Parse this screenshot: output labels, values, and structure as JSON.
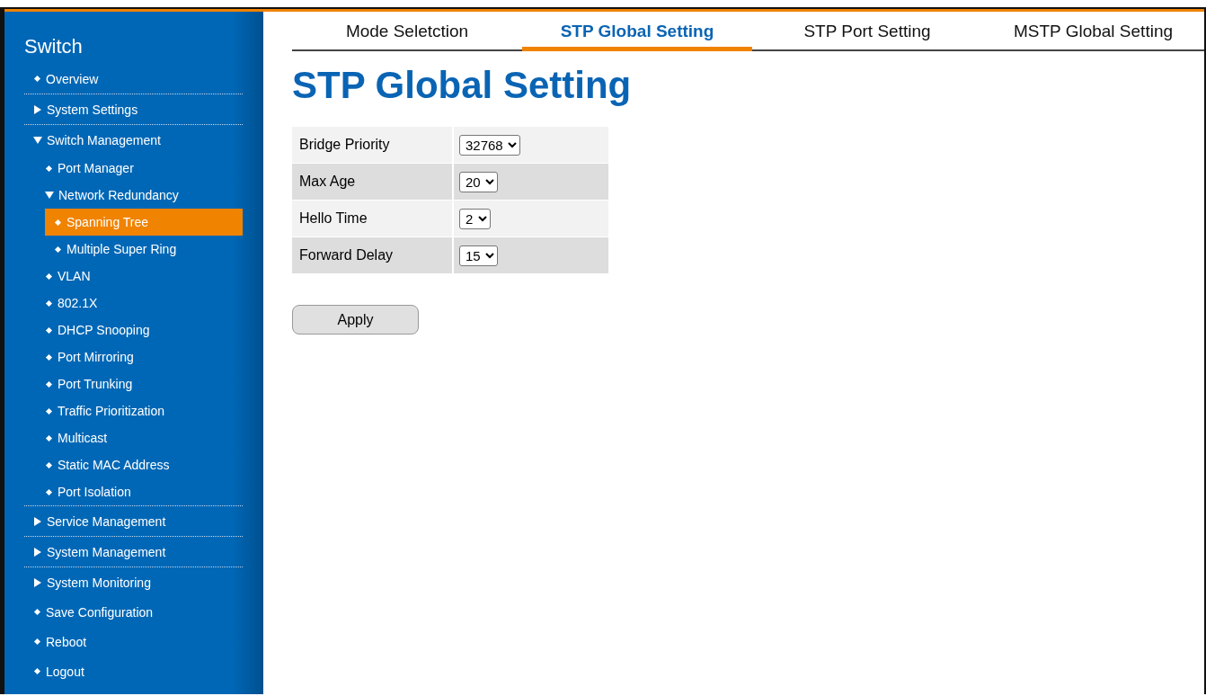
{
  "sidebar": {
    "title": "Switch",
    "items": [
      {
        "label": "Overview",
        "kind": "link",
        "selected": false
      },
      {
        "label": "System Settings",
        "kind": "group",
        "expanded": false,
        "selected": false
      },
      {
        "label": "Switch Management",
        "kind": "group",
        "expanded": true,
        "selected": false,
        "children": [
          {
            "label": "Port Manager",
            "kind": "link",
            "selected": false
          },
          {
            "label": "Network Redundancy",
            "kind": "group",
            "expanded": true,
            "selected": false,
            "children": [
              {
                "label": "Spanning Tree",
                "kind": "link",
                "selected": true
              },
              {
                "label": "Multiple Super Ring",
                "kind": "link",
                "selected": false
              }
            ]
          },
          {
            "label": "VLAN",
            "kind": "link",
            "selected": false
          },
          {
            "label": "802.1X",
            "kind": "link",
            "selected": false
          },
          {
            "label": "DHCP Snooping",
            "kind": "link",
            "selected": false
          },
          {
            "label": "Port Mirroring",
            "kind": "link",
            "selected": false
          },
          {
            "label": "Port Trunking",
            "kind": "link",
            "selected": false
          },
          {
            "label": "Traffic Prioritization",
            "kind": "link",
            "selected": false
          },
          {
            "label": "Multicast",
            "kind": "link",
            "selected": false
          },
          {
            "label": "Static MAC Address",
            "kind": "link",
            "selected": false
          },
          {
            "label": "Port Isolation",
            "kind": "link",
            "selected": false
          }
        ]
      },
      {
        "label": "Service Management",
        "kind": "group",
        "expanded": false,
        "selected": false
      },
      {
        "label": "System Management",
        "kind": "group",
        "expanded": false,
        "selected": false
      },
      {
        "label": "System Monitoring",
        "kind": "group",
        "expanded": false,
        "selected": false
      },
      {
        "label": "Save Configuration",
        "kind": "link",
        "selected": false
      },
      {
        "label": "Reboot",
        "kind": "link",
        "selected": false
      },
      {
        "label": "Logout",
        "kind": "link",
        "selected": false
      }
    ]
  },
  "tabs": [
    {
      "label": "Mode Seletction",
      "selected": false
    },
    {
      "label": "STP Global Setting",
      "selected": true
    },
    {
      "label": "STP Port Setting",
      "selected": false
    },
    {
      "label": "MSTP Global Setting",
      "selected": false
    }
  ],
  "heading": "STP Global Setting",
  "settings": [
    {
      "label": "Bridge Priority",
      "value": "32768"
    },
    {
      "label": "Max Age",
      "value": "20"
    },
    {
      "label": "Hello Time",
      "value": "2"
    },
    {
      "label": "Forward Delay",
      "value": "15"
    }
  ],
  "apply_button": "Apply"
}
